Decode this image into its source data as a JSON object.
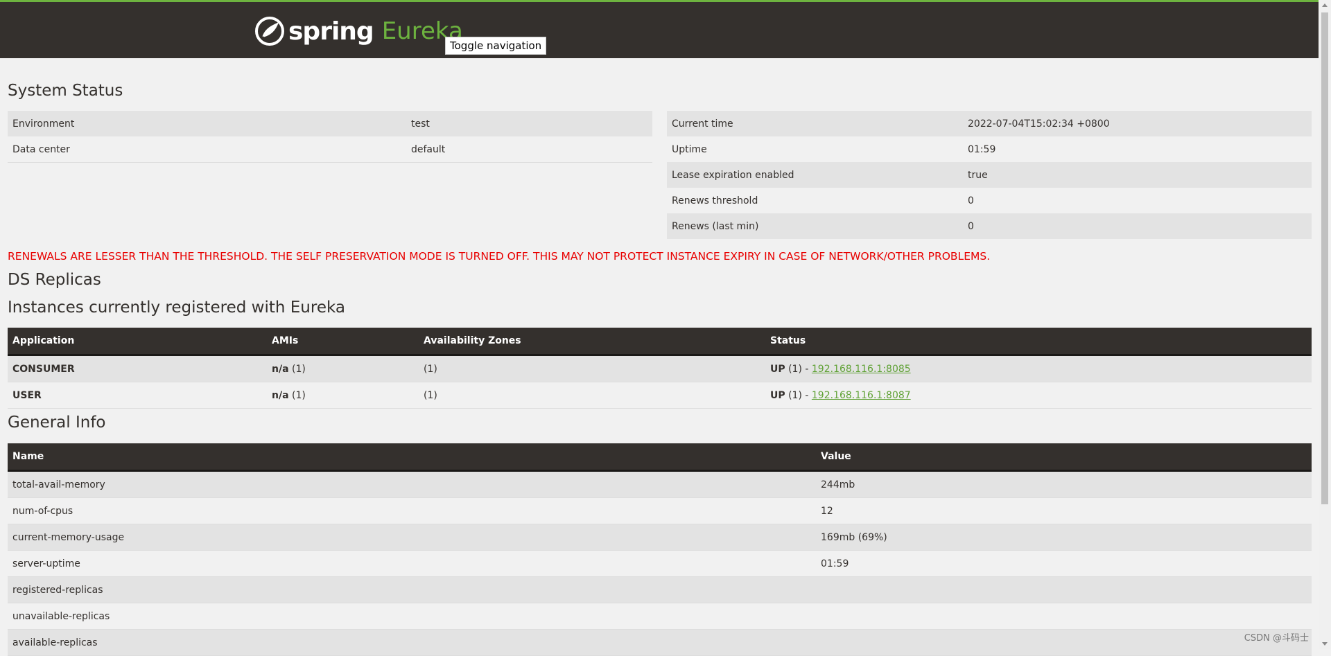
{
  "navbar": {
    "brand_spring": "spring",
    "brand_eureka": "Eureka",
    "toggle_label": "Toggle navigation"
  },
  "system_status": {
    "title": "System Status",
    "left": [
      {
        "label": "Environment",
        "value": "test"
      },
      {
        "label": "Data center",
        "value": "default"
      }
    ],
    "right": [
      {
        "label": "Current time",
        "value": "2022-07-04T15:02:34 +0800"
      },
      {
        "label": "Uptime",
        "value": "01:59"
      },
      {
        "label": "Lease expiration enabled",
        "value": "true"
      },
      {
        "label": "Renews threshold",
        "value": "0"
      },
      {
        "label": "Renews (last min)",
        "value": "0"
      }
    ]
  },
  "warning": "RENEWALS ARE LESSER THAN THE THRESHOLD. THE SELF PRESERVATION MODE IS TURNED OFF. THIS MAY NOT PROTECT INSTANCE EXPIRY IN CASE OF NETWORK/OTHER PROBLEMS.",
  "ds_replicas_title": "DS Replicas",
  "instances": {
    "title": "Instances currently registered with Eureka",
    "headers": [
      "Application",
      "AMIs",
      "Availability Zones",
      "Status"
    ],
    "rows": [
      {
        "app": "CONSUMER",
        "ami": "n/a",
        "ami_count": "(1)",
        "zones": "(1)",
        "status": "UP",
        "status_count": "(1) - ",
        "link": "192.168.116.1:8085"
      },
      {
        "app": "USER",
        "ami": "n/a",
        "ami_count": "(1)",
        "zones": "(1)",
        "status": "UP",
        "status_count": "(1) - ",
        "link": "192.168.116.1:8087"
      }
    ]
  },
  "general_info": {
    "title": "General Info",
    "headers": [
      "Name",
      "Value"
    ],
    "rows": [
      {
        "name": "total-avail-memory",
        "value": "244mb"
      },
      {
        "name": "num-of-cpus",
        "value": "12"
      },
      {
        "name": "current-memory-usage",
        "value": "169mb (69%)"
      },
      {
        "name": "server-uptime",
        "value": "01:59"
      },
      {
        "name": "registered-replicas",
        "value": ""
      },
      {
        "name": "unavailable-replicas",
        "value": ""
      },
      {
        "name": "available-replicas",
        "value": ""
      }
    ]
  },
  "watermark": "CSDN @斗码士",
  "colors": {
    "brand_green": "#6db33f",
    "nav_bg": "#34302d",
    "warning_red": "#e80000"
  }
}
